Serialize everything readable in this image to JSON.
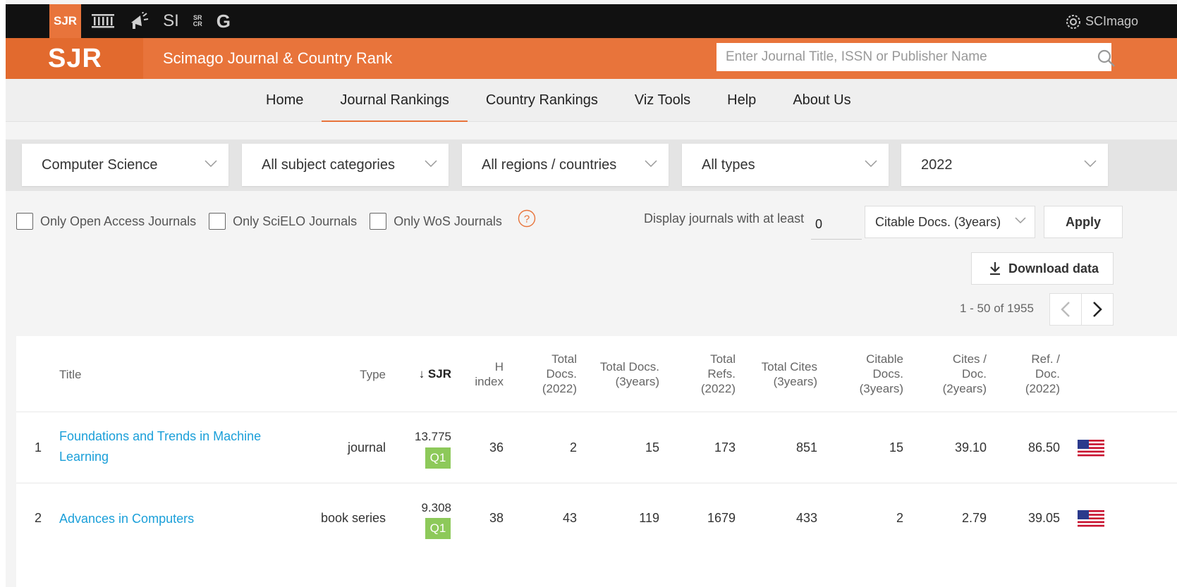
{
  "topbar": {
    "items": [
      "SJR",
      "SI",
      "SR",
      "CR",
      "G"
    ],
    "brand": "SCImago"
  },
  "header": {
    "logo": "SJR",
    "title": "Scimago Journal & Country Rank",
    "search_placeholder": "Enter Journal Title, ISSN or Publisher Name"
  },
  "nav": {
    "items": [
      {
        "label": "Home"
      },
      {
        "label": "Journal Rankings"
      },
      {
        "label": "Country Rankings"
      },
      {
        "label": "Viz Tools"
      },
      {
        "label": "Help"
      },
      {
        "label": "About Us"
      }
    ],
    "active": "Journal Rankings"
  },
  "filters": {
    "area": "Computer Science",
    "category": "All subject categories",
    "region": "All regions / countries",
    "type": "All types",
    "year": "2022"
  },
  "checks": {
    "open_access": "Only Open Access Journals",
    "scielo": "Only SciELO Journals",
    "wos": "Only WoS Journals"
  },
  "display_min": {
    "label": "Display journals with at least",
    "value": "0",
    "metric": "Citable Docs. (3years)",
    "apply": "Apply"
  },
  "download": "Download data",
  "pager": {
    "text": "1 - 50 of 1955"
  },
  "table": {
    "headers": {
      "title": "Title",
      "type": "Type",
      "sjr": "↓ SJR",
      "h_index": [
        "H",
        "index"
      ],
      "total_docs": [
        "Total",
        "Docs.",
        "(2022)"
      ],
      "total_docs_3y": [
        "Total Docs.",
        "(3years)"
      ],
      "total_refs": [
        "Total",
        "Refs.",
        "(2022)"
      ],
      "total_cites": [
        "Total Cites",
        "(3years)"
      ],
      "citable_docs": [
        "Citable",
        "Docs.",
        "(3years)"
      ],
      "cites_doc": [
        "Cites /",
        "Doc.",
        "(2years)"
      ],
      "ref_doc": [
        "Ref. /",
        "Doc.",
        "(2022)"
      ]
    },
    "rows": [
      {
        "rank": "1",
        "title": "Foundations and Trends in Machine Learning",
        "type": "journal",
        "sjr": "13.775",
        "quartile": "Q1",
        "h_index": "36",
        "total_docs": "2",
        "total_docs_3y": "15",
        "total_refs": "173",
        "total_cites": "851",
        "citable_docs": "15",
        "cites_doc": "39.10",
        "ref_doc": "86.50"
      },
      {
        "rank": "2",
        "title": "Advances in Computers",
        "type": "book series",
        "sjr": "9.308",
        "quartile": "Q1",
        "h_index": "38",
        "total_docs": "43",
        "total_docs_3y": "119",
        "total_refs": "1679",
        "total_cites": "433",
        "citable_docs": "2",
        "cites_doc": "2.79",
        "ref_doc": "39.05"
      }
    ]
  }
}
